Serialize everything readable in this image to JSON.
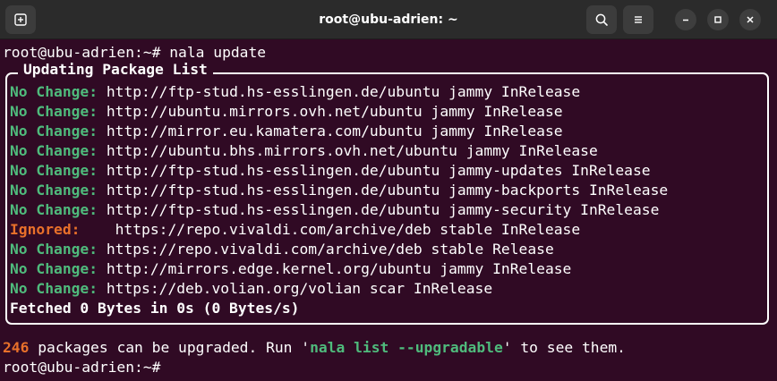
{
  "window": {
    "title": "root@ubu-adrien: ~"
  },
  "icons": {
    "new_tab": "new-tab-icon",
    "search": "search-icon",
    "menu": "hamburger-menu-icon",
    "minimize": "minimize-icon",
    "maximize": "maximize-icon",
    "close": "close-icon"
  },
  "colors": {
    "background": "#300a24",
    "header": "#2b2b2b",
    "status_green": "#4fbb7c",
    "status_orange": "#e8702a",
    "text": "#ffffff"
  },
  "terminal": {
    "prompt": "root@ubu-adrien:~#",
    "command": " nala update",
    "panel_title": "Updating Package List",
    "entries": [
      {
        "status": "No Change:",
        "text": " http://ftp-stud.hs-esslingen.de/ubuntu jammy InRelease",
        "type": "green"
      },
      {
        "status": "No Change:",
        "text": " http://ubuntu.mirrors.ovh.net/ubuntu jammy InRelease",
        "type": "green"
      },
      {
        "status": "No Change:",
        "text": " http://mirror.eu.kamatera.com/ubuntu jammy InRelease",
        "type": "green"
      },
      {
        "status": "No Change:",
        "text": " http://ubuntu.bhs.mirrors.ovh.net/ubuntu jammy InRelease",
        "type": "green"
      },
      {
        "status": "No Change:",
        "text": " http://ftp-stud.hs-esslingen.de/ubuntu jammy-updates InRelease",
        "type": "green"
      },
      {
        "status": "No Change:",
        "text": " http://ftp-stud.hs-esslingen.de/ubuntu jammy-backports InRelease",
        "type": "green"
      },
      {
        "status": "No Change:",
        "text": " http://ftp-stud.hs-esslingen.de/ubuntu jammy-security InRelease",
        "type": "green"
      },
      {
        "status": "Ignored:",
        "text": "    https://repo.vivaldi.com/archive/deb stable InRelease",
        "type": "orange"
      },
      {
        "status": "No Change:",
        "text": " https://repo.vivaldi.com/archive/deb stable Release",
        "type": "green"
      },
      {
        "status": "No Change:",
        "text": " http://mirrors.edge.kernel.org/ubuntu jammy InRelease",
        "type": "green"
      },
      {
        "status": "No Change:",
        "text": " https://deb.volian.org/volian scar InRelease",
        "type": "green"
      }
    ],
    "fetched": "Fetched 0 Bytes in 0s (0 Bytes/s)",
    "summary": {
      "count": "246",
      "middle": " packages can be upgraded. Run '",
      "command": "nala list --upgradable",
      "end": "' to see them."
    },
    "final_prompt": "root@ubu-adrien:~#"
  }
}
